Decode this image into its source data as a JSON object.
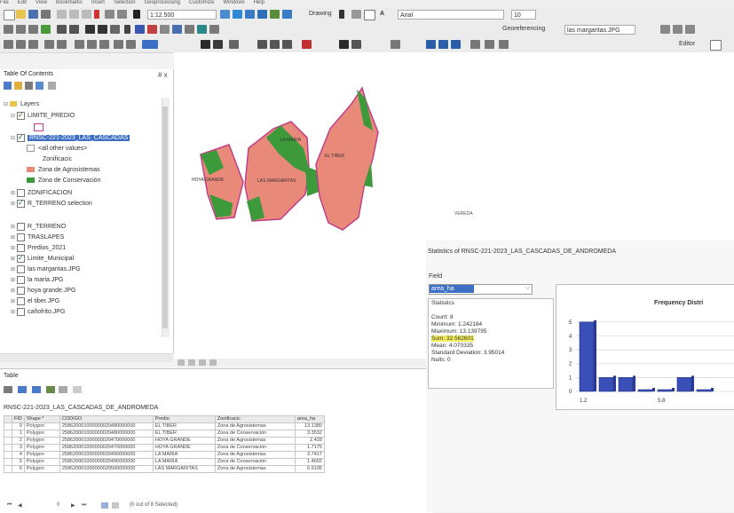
{
  "menubar": [
    "File",
    "Edit",
    "View",
    "Bookmarks",
    "Insert",
    "Selection",
    "Geoprocessing",
    "Customize",
    "Windows",
    "Help"
  ],
  "toolbar": {
    "scale": "1:12.500",
    "drawing_label": "Drawing",
    "font_combo": "Arial",
    "font_size": "10",
    "georef_label": "Georeferencing",
    "georef_layer": "las margaritas.JPG",
    "editor_label": "Editor"
  },
  "toc": {
    "title": "Table Of Contents",
    "close": "# x",
    "layers_root": "Layers",
    "items": [
      {
        "label": "LIMITE_PREDIO",
        "checked": true,
        "expanded": true
      },
      {
        "label": "RNSC-221-2023_LAS_CASCADAS",
        "checked": true,
        "expanded": true,
        "selected": true
      },
      {
        "label": "ZONIFICACION",
        "checked": false,
        "expanded": false
      },
      {
        "label": "R_TERRENO selection",
        "checked": true,
        "expanded": false
      },
      {
        "label": "R_TERRENO",
        "checked": false,
        "expanded": false
      },
      {
        "label": "TRASLAPES",
        "checked": false,
        "expanded": false
      },
      {
        "label": "Predios_2021",
        "checked": false,
        "expanded": false
      },
      {
        "label": "Limite_Municipal",
        "checked": true,
        "expanded": false
      },
      {
        "label": "las margaritas.JPG",
        "checked": false,
        "expanded": false
      },
      {
        "label": "la maria.JPG",
        "checked": false,
        "expanded": false
      },
      {
        "label": "hoya grande.JPG",
        "checked": false,
        "expanded": false
      },
      {
        "label": "el tiber.JPG",
        "checked": false,
        "expanded": false
      },
      {
        "label": "cañofrito.JPG",
        "checked": false,
        "expanded": false
      }
    ],
    "legend": {
      "other": "<all other values>",
      "field": "Zonificacic",
      "agro": "Zona de Agrosistemas",
      "cons": "Zona de Conservación"
    }
  },
  "colors": {
    "agro": "#e8897a",
    "cons": "#3d9a3a",
    "boundary": "#c13f8a",
    "selection": "#3d6fc4",
    "highlight": "#f4ee60",
    "bars": "#3a50b8"
  },
  "map": {
    "labels": {
      "hoya_grande": "HOYA GRANDE",
      "la_maria": "LA MARIA",
      "las_margaritas": "LAS MARGARITAS",
      "el_tiber": "EL TIBER",
      "vereda": "VEREDA"
    }
  },
  "table_window": {
    "title": "Table",
    "layer": "RNSC-221-2023_LAS_CASCADAS_DE_ANDROMEDA",
    "columns": [
      "FID",
      "Shape *",
      "CODIGO",
      "Predio",
      "Zonificacic",
      "area_ha"
    ],
    "rows": [
      [
        "0",
        "Polygon",
        "258620001000000020480000000",
        "EL TIBER",
        "Zona de Agrosistemas",
        "13.1380"
      ],
      [
        "1",
        "Polygon",
        "258620001000000020480000000",
        "EL TIBER",
        "Zona de Conservación",
        "3.3532"
      ],
      [
        "2",
        "Polygon",
        "258620001000000020470000000",
        "HOYA GRANDE",
        "Zona de Agrosistemas",
        "2.428"
      ],
      [
        "3",
        "Polygon",
        "258620001000000020470000000",
        "HOYA GRANDE",
        "Zona de Conservación",
        "1.7175"
      ],
      [
        "4",
        "Polygon",
        "258620001000000020490000000",
        "LA MARIA",
        "Zona de Agrosistemas",
        "3.7417"
      ],
      [
        "5",
        "Polygon",
        "258620001000000020490000000",
        "LA MARIA",
        "Zona de Conservación",
        "1.4602"
      ],
      [
        "6",
        "Polygon",
        "258620001000000020500000000",
        "LAS MARGARITAS",
        "Zona de Agrosistemas",
        "6.9105"
      ]
    ],
    "footer": "(0 out of 8 Selected)",
    "record": "0"
  },
  "statistics": {
    "title": "Statistics of RNSC-221-2023_LAS_CASCADAS_DE_ANDROMEDA",
    "field_label": "Field",
    "field_value": "area_ha",
    "stats_label": "Statistics",
    "count": "Count:    8",
    "minimum": "Minimum:  1.242184",
    "maximum": "Maximum:  13.139795",
    "sum": "Sum:      32.562601",
    "mean": "Mean:     4.070335",
    "std": "Standard Deviation:  3.95014",
    "nulls": "Nulls:    0",
    "chart_title": "Frequency Distri"
  },
  "chart_data": {
    "type": "bar",
    "title": "Frequency Distri",
    "x_ticks": [
      "1.2",
      "5.8"
    ],
    "y_ticks": [
      "0",
      "1",
      "2",
      "3",
      "4",
      "5"
    ],
    "ylim": [
      0,
      5.5
    ],
    "bins": [
      1.2,
      2.4,
      3.6,
      4.8,
      5.8,
      7.0,
      8.2
    ],
    "values": [
      5,
      1,
      1,
      0,
      0,
      1,
      0
    ]
  }
}
